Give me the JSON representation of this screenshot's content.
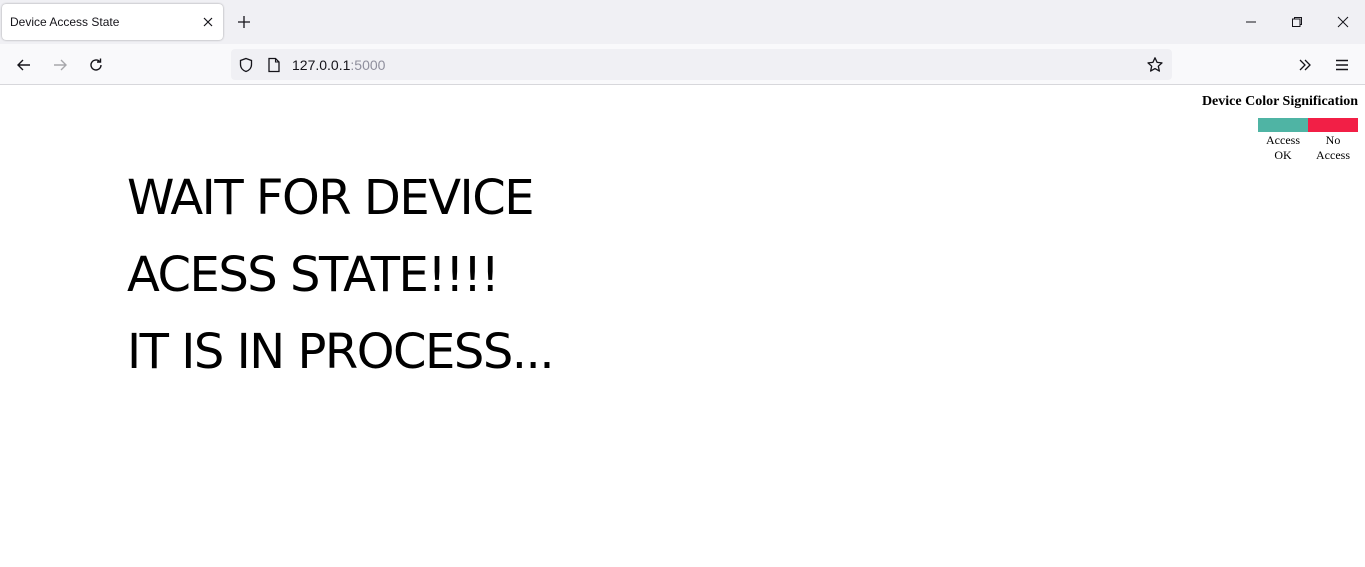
{
  "browser": {
    "tab_title": "Device Access State",
    "url_host": "127.0.0.1",
    "url_port": ":5000",
    "icons": {
      "tab_close": "close-icon",
      "new_tab": "plus-icon",
      "minimize": "minimize-icon",
      "restore": "restore-icon",
      "close_window": "close-icon",
      "back": "arrow-left-icon",
      "forward": "arrow-right-icon",
      "reload": "reload-icon",
      "shield": "shield-icon",
      "page": "page-icon",
      "bookmark": "star-icon",
      "overflow": "chevron-double-right-icon",
      "menu": "hamburger-icon"
    }
  },
  "legend": {
    "title": "Device Color Signification",
    "items": [
      {
        "label": "Access OK",
        "color": "#4fb4a4"
      },
      {
        "label": "No Access",
        "color": "#f21f46"
      }
    ]
  },
  "message": {
    "line1": "WAIT FOR DEVICE",
    "line2": "ACESS STATE!!!!",
    "line3": "IT IS IN PROCESS..."
  }
}
